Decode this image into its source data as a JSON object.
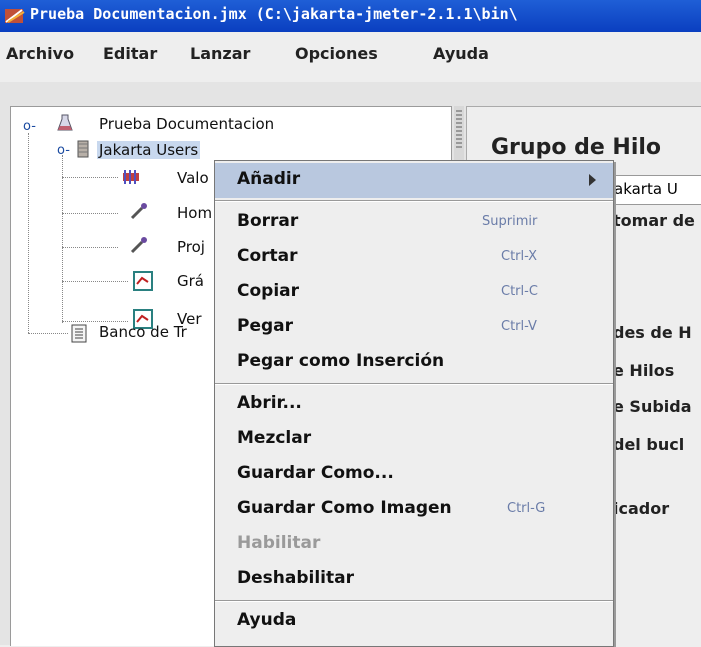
{
  "window": {
    "title": "Prueba Documentacion.jmx (C:\\jakarta-jmeter-2.1.1\\bin\\"
  },
  "menubar": [
    {
      "label": "Archivo"
    },
    {
      "label": "Editar"
    },
    {
      "label": "Lanzar"
    },
    {
      "label": "Opciones"
    },
    {
      "label": "Ayuda"
    }
  ],
  "tree": {
    "root": "Prueba Documentacion",
    "group": "Jakarta Users",
    "children": [
      "Valo",
      "Hom",
      "Proj",
      "Grá",
      "Ver"
    ],
    "workbench": "Banco de Tr"
  },
  "right_panel": {
    "title": "Grupo de Hilo",
    "name_value": "akarta U",
    "lines": [
      "tomar de",
      "des de H",
      "e Hilos",
      "e Subida",
      "del bucl",
      "icador"
    ]
  },
  "context_menu": [
    {
      "label": "Añadir",
      "accel": "",
      "submenu": true
    },
    {
      "label": "Borrar",
      "accel": "Suprimir"
    },
    {
      "label": "Cortar",
      "accel": "Ctrl-X"
    },
    {
      "label": "Copiar",
      "accel": "Ctrl-C"
    },
    {
      "label": "Pegar",
      "accel": "Ctrl-V"
    },
    {
      "label": "Pegar como Inserción",
      "accel": ""
    },
    {
      "label": "Abrir...",
      "accel": ""
    },
    {
      "label": "Mezclar",
      "accel": ""
    },
    {
      "label": "Guardar Como...",
      "accel": ""
    },
    {
      "label": "Guardar Como Imagen",
      "accel": "Ctrl-G"
    },
    {
      "label": "Habilitar",
      "accel": "",
      "disabled": true
    },
    {
      "label": "Deshabilitar",
      "accel": ""
    },
    {
      "label": "Ayuda",
      "accel": ""
    }
  ]
}
